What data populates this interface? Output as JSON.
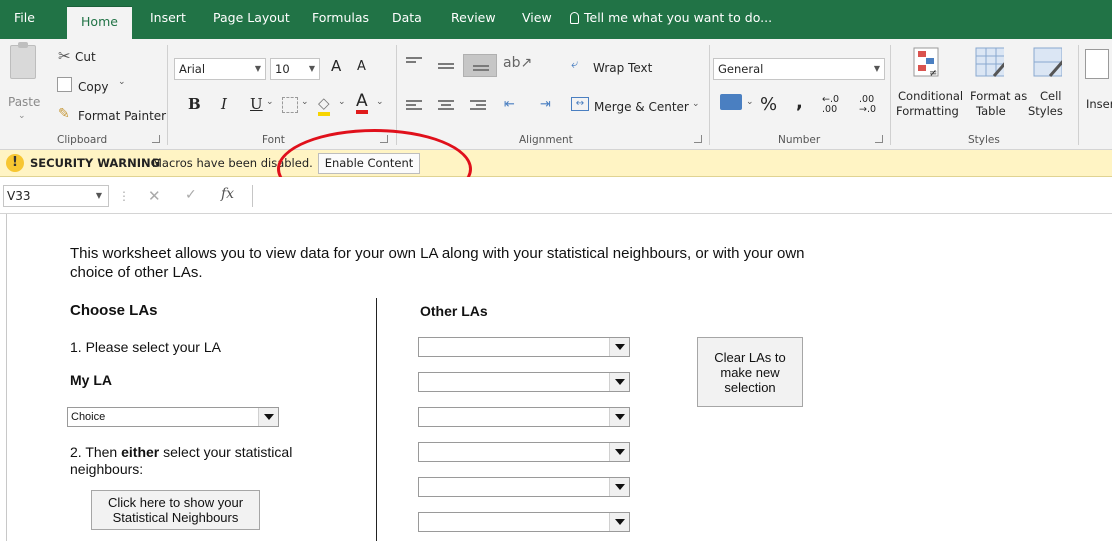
{
  "tabs": {
    "file": "File",
    "home": "Home",
    "insert": "Insert",
    "page_layout": "Page Layout",
    "formulas": "Formulas",
    "data": "Data",
    "review": "Review",
    "view": "View",
    "tell_me": "Tell me what you want to do..."
  },
  "clipboard": {
    "paste": "Paste",
    "cut": "Cut",
    "copy": "Copy",
    "format_painter": "Format Painter",
    "group_label": "Clipboard"
  },
  "font": {
    "family": "Arial",
    "size": "10",
    "grow": "A",
    "shrink": "A",
    "bold": "B",
    "italic": "I",
    "underline": "U",
    "font_color": "A",
    "group_label": "Font"
  },
  "alignment": {
    "wrap_text": "Wrap Text",
    "merge_center": "Merge & Center",
    "group_label": "Alignment"
  },
  "number": {
    "format": "General",
    "percent": "%",
    "comma": ",",
    "increase_decimal": "←.0 .00",
    "decrease_decimal": ".00 →.0",
    "group_label": "Number"
  },
  "styles": {
    "conditional_formatting": [
      "Conditional",
      "Formatting"
    ],
    "format_as_table": [
      "Format as",
      "Table"
    ],
    "cell_styles": [
      "Cell",
      "Styles"
    ],
    "group_label": "Styles",
    "insert": "Inser"
  },
  "security": {
    "title": "SECURITY WARNING",
    "message": "Macros have been disabled.",
    "enable_button": "Enable Content"
  },
  "formula_bar": {
    "name_box": "V33",
    "fx": "fx",
    "value": ""
  },
  "sheet": {
    "intro": "This worksheet allows you to view data for your own LA along with your statistical neighbours, or with your own choice of other LAs.",
    "choose_heading": "Choose LAs",
    "step1": "1. Please select your LA",
    "my_la_heading": "My LA",
    "my_la_value": "Choice",
    "step2_prefix": "2. Then ",
    "step2_bold": "either",
    "step2_suffix": " select your statistical neighbours:",
    "show_neighbours_button": "Click here to show your Statistical Neighbours",
    "other_heading": "Other LAs",
    "other_las": [
      "",
      "",
      "",
      "",
      "",
      ""
    ],
    "clear_button": "Clear LAs to make new selection"
  },
  "colors": {
    "excel_green": "#217346",
    "warning_bar": "#fff4c4",
    "annotation_circle": "#e0101b"
  }
}
